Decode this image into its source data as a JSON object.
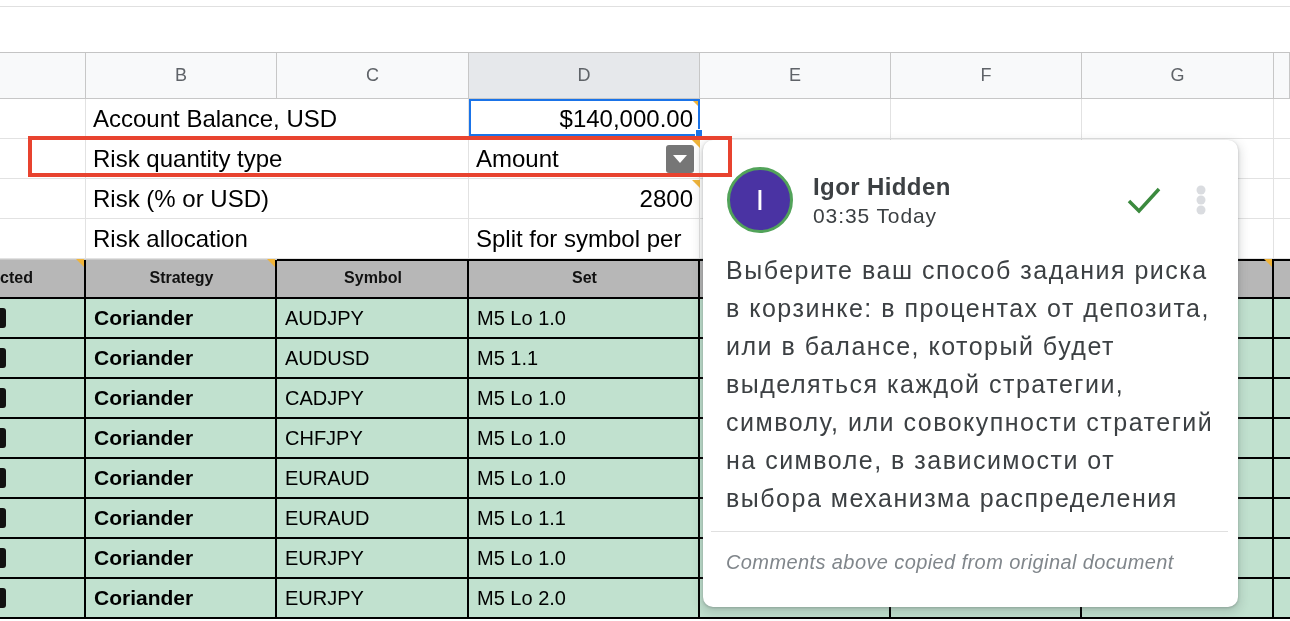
{
  "columns": [
    {
      "label": "B",
      "selected": false
    },
    {
      "label": "C",
      "selected": false
    },
    {
      "label": "D",
      "selected": true
    },
    {
      "label": "E",
      "selected": false
    },
    {
      "label": "F",
      "selected": false
    },
    {
      "label": "G",
      "selected": false
    }
  ],
  "settings": [
    {
      "label": "Account Balance, USD",
      "value": "$140,000.00",
      "kind": "number",
      "selected": true,
      "comment": true,
      "highlighted": false
    },
    {
      "label": "Risk quantity type",
      "value": "Amount",
      "kind": "dropdown",
      "selected": false,
      "comment": true,
      "highlighted": true
    },
    {
      "label": "Risk (% or USD)",
      "value": "2800",
      "kind": "number",
      "selected": false,
      "comment": true,
      "highlighted": false
    },
    {
      "label": "Risk allocation",
      "value": "Split for symbol per",
      "kind": "text",
      "selected": false,
      "comment": false,
      "highlighted": false
    }
  ],
  "table": {
    "header": [
      {
        "label": "cted",
        "comment": true
      },
      {
        "label": "Strategy",
        "comment": true
      },
      {
        "label": "Symbol",
        "comment": false
      },
      {
        "label": "Set",
        "comment": false
      },
      {
        "comment": false
      },
      {
        "comment": false
      },
      {
        "comment": true
      },
      {
        "comment": false
      }
    ],
    "rows": [
      {
        "strategy": "Coriander",
        "symbol": "AUDJPY",
        "set": "M5 Lo 1.0"
      },
      {
        "strategy": "Coriander",
        "symbol": "AUDUSD",
        "set": "M5 1.1"
      },
      {
        "strategy": "Coriander",
        "symbol": "CADJPY",
        "set": "M5 Lo 1.0"
      },
      {
        "strategy": "Coriander",
        "symbol": "CHFJPY",
        "set": "M5 Lo 1.0"
      },
      {
        "strategy": "Coriander",
        "symbol": "EURAUD",
        "set": "M5 Lo 1.0"
      },
      {
        "strategy": "Coriander",
        "symbol": "EURAUD",
        "set": "M5 Lo 1.1"
      },
      {
        "strategy": "Coriander",
        "symbol": "EURJPY",
        "set": "M5 Lo 1.0"
      },
      {
        "strategy": "Coriander",
        "symbol": "EURJPY",
        "set": "M5 Lo 2.0"
      }
    ]
  },
  "comment": {
    "initial": "I",
    "author": "Igor Hidden",
    "time": "03:35 Today",
    "text": "Выберите ваш способ задания риска в корзинке: в процентах от депозита, или в балансе, который будет выделяться каждой стратегии, символу, или совокупности стратегий на символе, в зависимости от выбора механизма распределения",
    "note": "Comments above copied from original document"
  }
}
